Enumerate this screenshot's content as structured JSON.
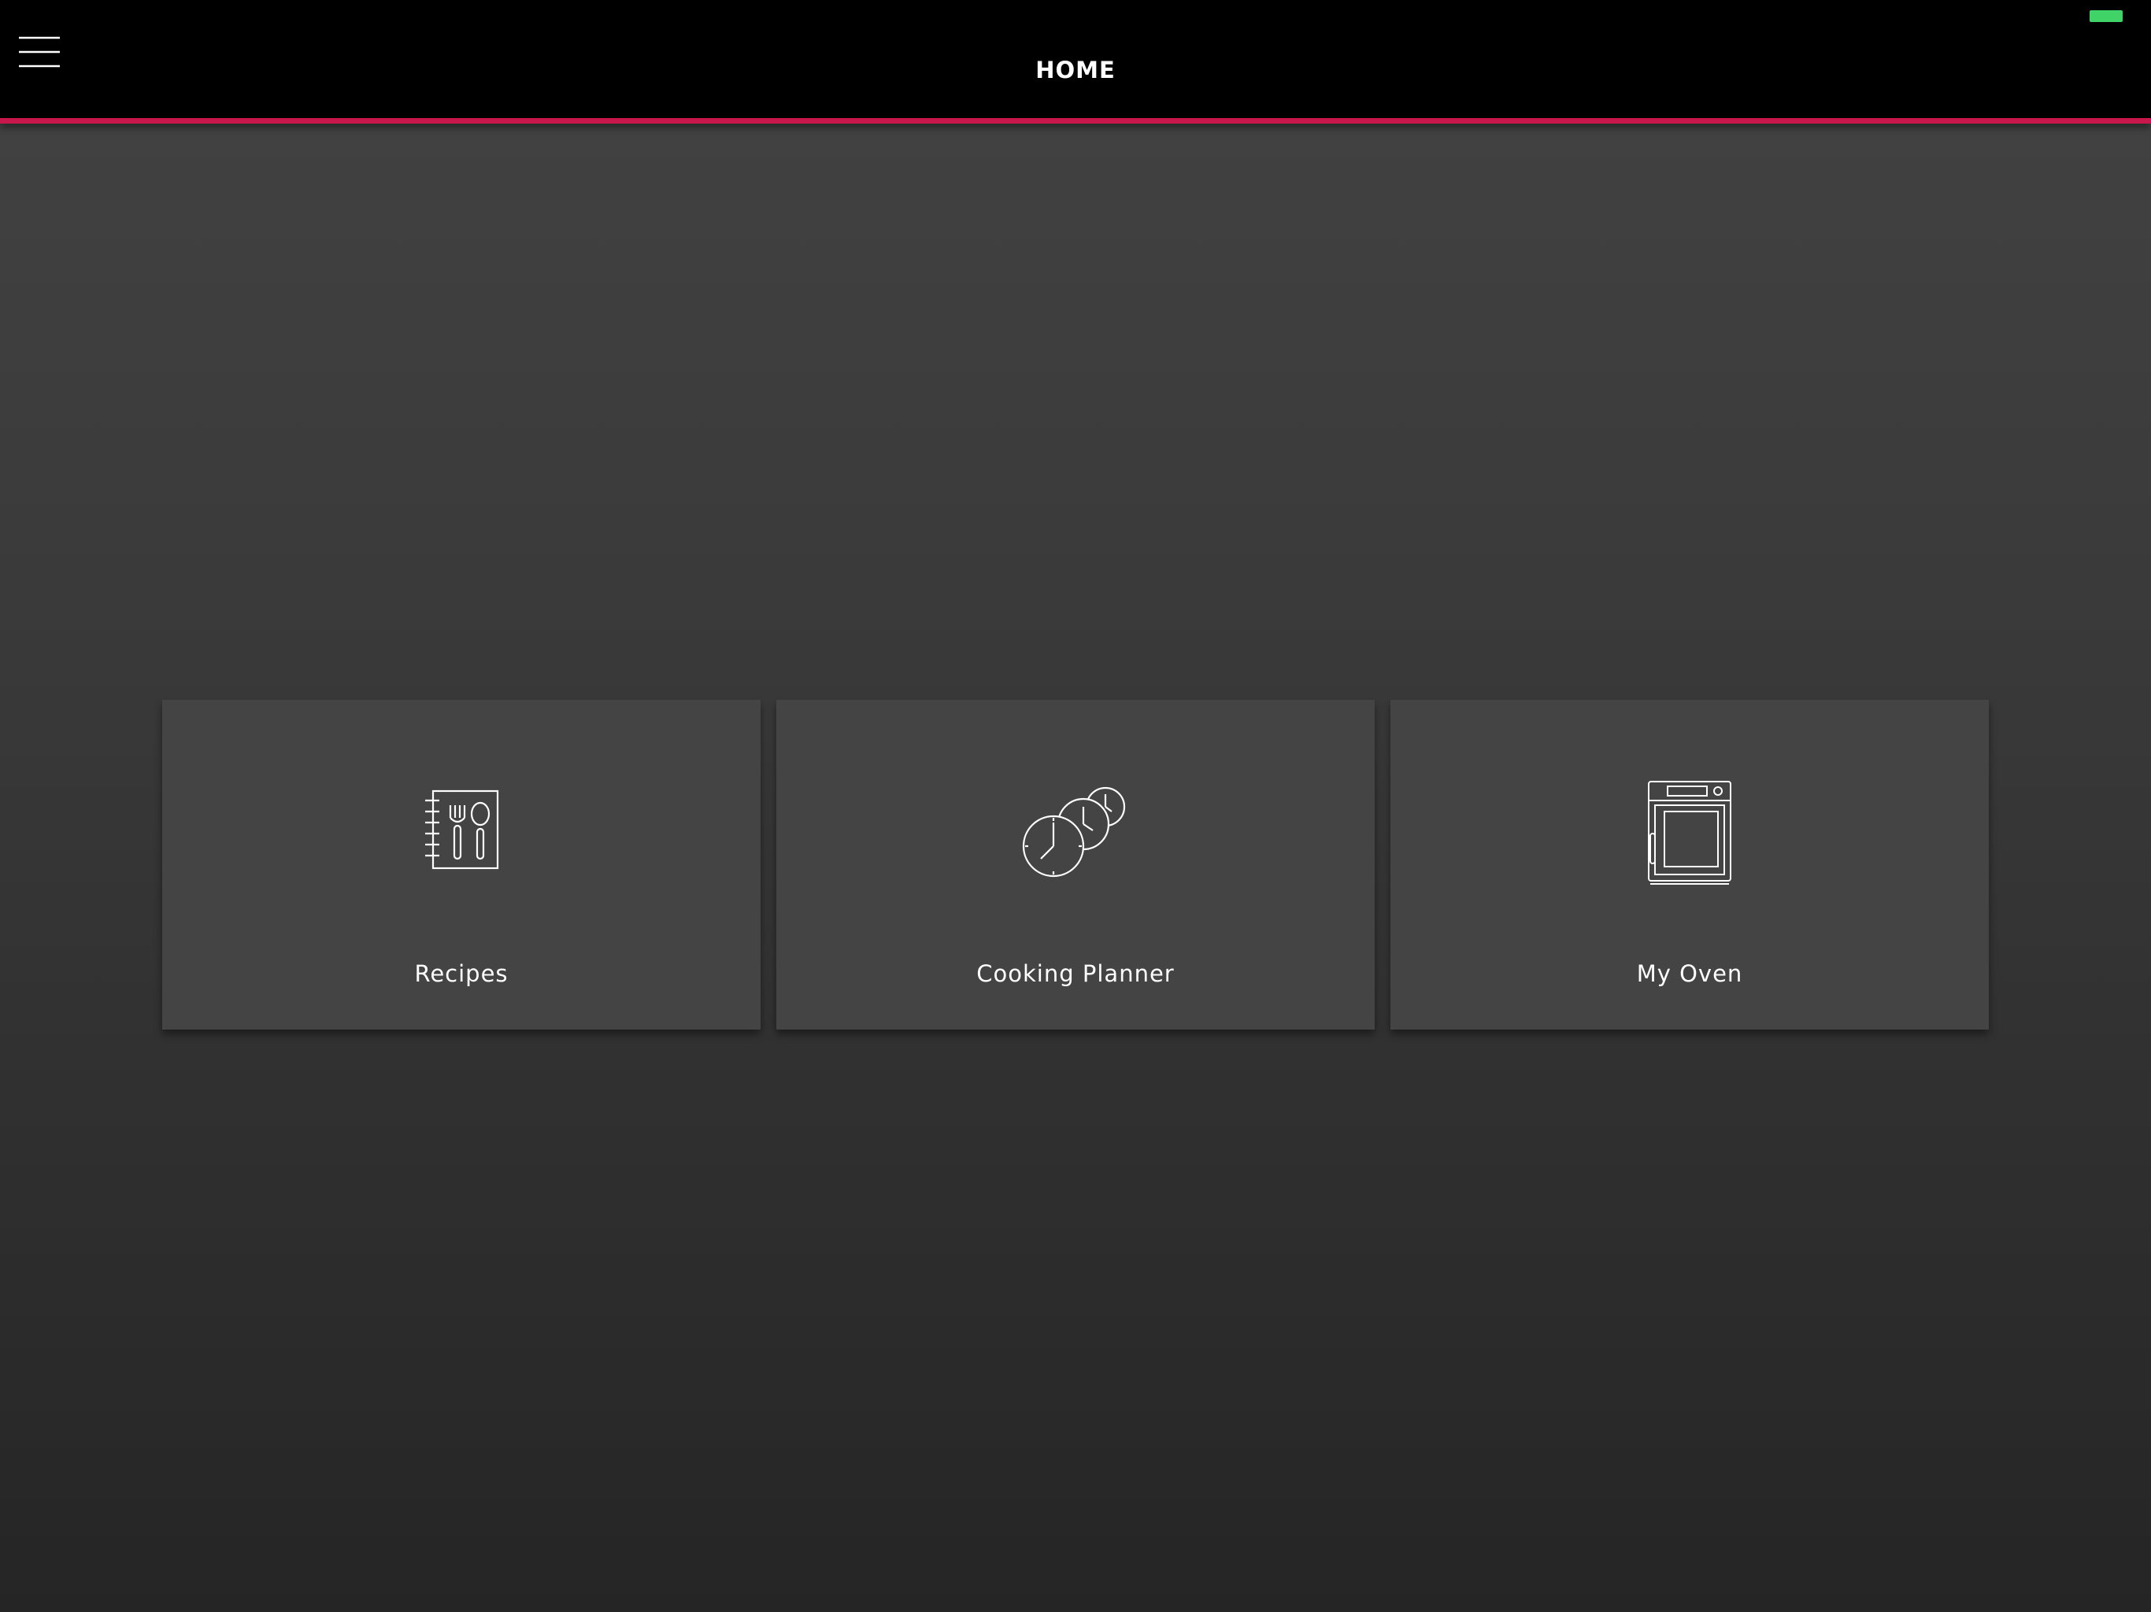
{
  "header": {
    "title": "HOME",
    "menu_icon": "hamburger-menu-icon",
    "battery_color": "#3fd368"
  },
  "theme": {
    "accent": "#c8174a",
    "header_bg": "#000000",
    "tile_bg": "#444444"
  },
  "tiles": [
    {
      "label": "Recipes",
      "icon": "recipe-book-icon"
    },
    {
      "label": "Cooking Planner",
      "icon": "clocks-icon"
    },
    {
      "label": "My Oven",
      "icon": "oven-icon"
    }
  ]
}
